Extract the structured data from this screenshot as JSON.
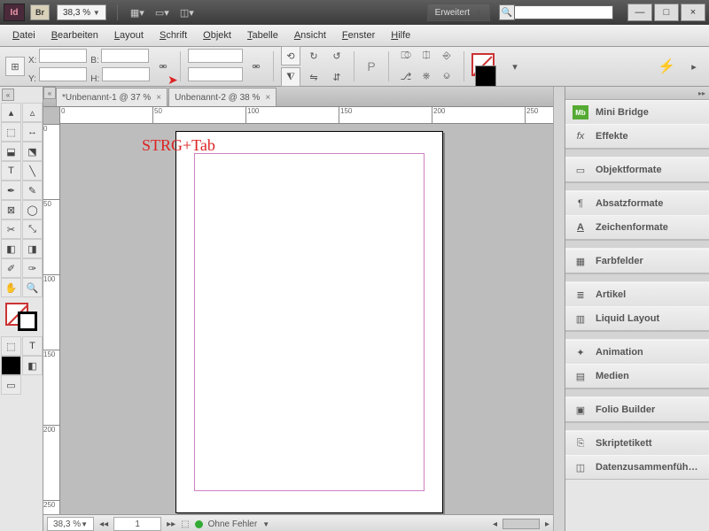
{
  "titlebar": {
    "app_abbr": "Id",
    "bridge_abbr": "Br",
    "zoom": "38,3 %",
    "workspace": "Erweitert"
  },
  "window_controls": {
    "min": "—",
    "max": "□",
    "close": "×"
  },
  "menu": {
    "items": [
      "Datei",
      "Bearbeiten",
      "Layout",
      "Schrift",
      "Objekt",
      "Tabelle",
      "Ansicht",
      "Fenster",
      "Hilfe"
    ]
  },
  "controlbar": {
    "x_label": "X:",
    "y_label": "Y:",
    "b_label": "B:",
    "h_label": "H:"
  },
  "tabs": [
    {
      "label": "*Unbenannt-1 @ 37 %"
    },
    {
      "label": "Unbenannt-2 @ 38 %"
    }
  ],
  "ruler_marks_h": [
    "0",
    "50",
    "100",
    "150",
    "200",
    "250"
  ],
  "ruler_marks_v": [
    "0",
    "50",
    "100",
    "150",
    "200",
    "250"
  ],
  "annotation": "STRG+Tab",
  "status": {
    "zoom": "38,3 %",
    "page": "1",
    "preflight": "Ohne Fehler"
  },
  "panels": {
    "group1": [
      {
        "icon": "Mb",
        "label": "Mini Bridge"
      },
      {
        "icon": "fx",
        "label": "Effekte"
      }
    ],
    "group2": [
      {
        "icon": "▭",
        "label": "Objektformate"
      }
    ],
    "group3": [
      {
        "icon": "¶",
        "label": "Absatzformate"
      },
      {
        "icon": "A",
        "label": "Zeichenformate"
      }
    ],
    "group4": [
      {
        "icon": "▦",
        "label": "Farbfelder"
      }
    ],
    "group5": [
      {
        "icon": "≣",
        "label": "Artikel"
      },
      {
        "icon": "▥",
        "label": "Liquid Layout"
      }
    ],
    "group6": [
      {
        "icon": "✦",
        "label": "Animation"
      },
      {
        "icon": "▤",
        "label": "Medien"
      }
    ],
    "group7": [
      {
        "icon": "▣",
        "label": "Folio Builder"
      }
    ],
    "group8": [
      {
        "icon": "⎘",
        "label": "Skriptetikett"
      },
      {
        "icon": "◫",
        "label": "Datenzusammenfüh…"
      }
    ]
  }
}
